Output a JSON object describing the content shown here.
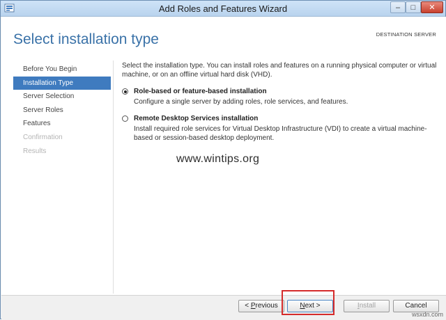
{
  "window": {
    "title": "Add Roles and Features Wizard",
    "minimize_label": "–",
    "maximize_label": "□",
    "close_label": "✕"
  },
  "header": {
    "page_title": "Select installation type",
    "destination_server": "DESTINATION SERVER"
  },
  "nav": {
    "items": [
      {
        "label": "Before You Begin",
        "state": "normal"
      },
      {
        "label": "Installation Type",
        "state": "selected"
      },
      {
        "label": "Server Selection",
        "state": "normal"
      },
      {
        "label": "Server Roles",
        "state": "normal"
      },
      {
        "label": "Features",
        "state": "normal"
      },
      {
        "label": "Confirmation",
        "state": "disabled"
      },
      {
        "label": "Results",
        "state": "disabled"
      }
    ]
  },
  "main": {
    "description": "Select the installation type. You can install roles and features on a running physical computer or virtual machine, or on an offline virtual hard disk (VHD).",
    "options": [
      {
        "label": "Role-based or feature-based installation",
        "description": "Configure a single server by adding roles, role services, and features.",
        "checked": true
      },
      {
        "label": "Remote Desktop Services installation",
        "description": "Install required role services for Virtual Desktop Infrastructure (VDI) to create a virtual machine-based or session-based desktop deployment.",
        "checked": false
      }
    ],
    "watermark": "www.wintips.org"
  },
  "footer": {
    "previous": {
      "prefix": "< ",
      "underlined": "P",
      "rest": "revious"
    },
    "next": {
      "underlined": "N",
      "rest": "ext >"
    },
    "install": {
      "underlined": "I",
      "rest": "nstall"
    },
    "cancel": "Cancel"
  },
  "corner_mark": "wsxdn.com",
  "colors": {
    "accent": "#3f7bbf",
    "title": "#3a72a8",
    "highlight": "#d52a2a"
  }
}
